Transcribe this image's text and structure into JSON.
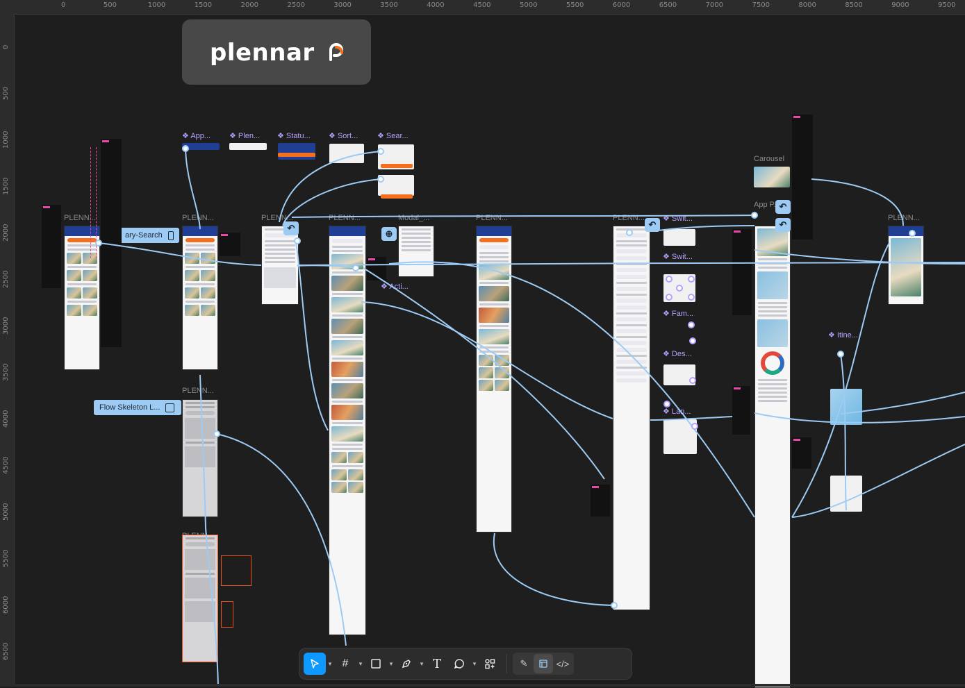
{
  "ruler": {
    "top": [
      "0",
      "500",
      "1000",
      "1500",
      "2000",
      "2500",
      "3000",
      "3500",
      "4000",
      "4500",
      "5000",
      "5500",
      "6000",
      "6500",
      "7000",
      "7500",
      "8000",
      "8500",
      "9000",
      "9500"
    ],
    "left": [
      "0",
      "500",
      "1000",
      "1500",
      "2000",
      "2500",
      "3000",
      "3500",
      "4000",
      "4500",
      "5000",
      "5500",
      "6000",
      "6500"
    ]
  },
  "logo": {
    "text": "plennar"
  },
  "frame_labels": {
    "f1": "PLENN...",
    "f2": "PLENN...",
    "f3": "PLENN...",
    "f4": "PLENN...",
    "f5": "Modal_...",
    "f6": "PLENN...",
    "f7": "PLENN...",
    "f8": "PLENN...",
    "f9": "PLENN...",
    "f10": "PLENN...",
    "f11": "Carousel",
    "f12": "App P..."
  },
  "component_labels": {
    "app": "App...",
    "plen": "Plen...",
    "statu": "Statu...",
    "sort": "Sort...",
    "sear": "Sear...",
    "acti": "Acti...",
    "swit1": "Swit...",
    "swit2": "Swit...",
    "fam": "Fam...",
    "des": "Des...",
    "lan": "Lan...",
    "itine": "Itine..."
  },
  "notes": {
    "search": "ary-Search",
    "skeleton": "Flow Skeleton L..."
  },
  "toolbar": {
    "tools": [
      "move-tool",
      "frame-tool",
      "shape-tool",
      "pen-tool",
      "text-tool",
      "comment-tool",
      "actions-tool"
    ],
    "modes": [
      "draw-mode",
      "design-mode",
      "dev-mode"
    ],
    "active_tool": "move-tool",
    "active_mode": "design-mode"
  },
  "colors": {
    "canvas": "#1e1e1e",
    "flow": "#9dcbf3",
    "accent": "#0d99ff",
    "component": "#b8a0ff",
    "brand_orange": "#f4701f",
    "brand_navy": "#1f3e94"
  }
}
